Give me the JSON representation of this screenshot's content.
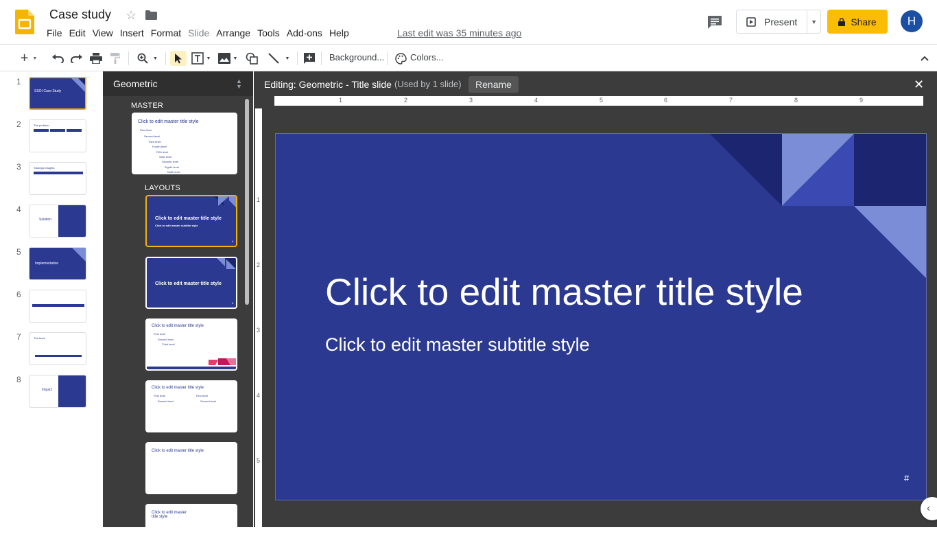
{
  "header": {
    "doc_title": "Case study",
    "menu": [
      "File",
      "Edit",
      "View",
      "Insert",
      "Format",
      "Slide",
      "Arrange",
      "Tools",
      "Add-ons",
      "Help"
    ],
    "last_edit": "Last edit was 35 minutes ago",
    "present_label": "Present",
    "share_label": "Share",
    "avatar_initial": "H"
  },
  "toolbar": {
    "background_label": "Background...",
    "colors_label": "Colors..."
  },
  "filmstrip": {
    "slides": [
      {
        "num": "1",
        "text": "SSOI Case Study"
      },
      {
        "num": "2",
        "text": "The problem"
      },
      {
        "num": "3",
        "text": "Strategic insights"
      },
      {
        "num": "4",
        "text": "Solution"
      },
      {
        "num": "5",
        "text": "Implementation"
      },
      {
        "num": "6",
        "text": ""
      },
      {
        "num": "7",
        "text": "The team"
      },
      {
        "num": "8",
        "text": "Impact"
      }
    ]
  },
  "theme_panel": {
    "theme_name": "Geometric",
    "master_label": "MASTER",
    "layouts_label": "LAYOUTS",
    "master_title": "Click to edit master title style",
    "master_levels": [
      "First level",
      "Second level",
      "Third level",
      "Fourth level",
      "Fifth level",
      "Sixth level",
      "Seventh level",
      "Eighth level",
      "Ninth level"
    ],
    "layout_title": "Click to edit master title style",
    "layout_subtitle": "Click to edit master subtitle style",
    "layout_num": "#"
  },
  "editor": {
    "editing_label": "Editing: Geometric - Title slide",
    "used_label": "(Used by 1 slide)",
    "rename_label": "Rename",
    "ruler_h": [
      "1",
      "2",
      "3",
      "4",
      "5",
      "6",
      "7",
      "8",
      "9"
    ],
    "ruler_v": [
      "1",
      "2",
      "3",
      "4",
      "5"
    ],
    "slide": {
      "title": "Click to edit master title style",
      "subtitle": "Click to edit master subtitle style",
      "number": "#"
    }
  },
  "colors": {
    "accent": "#fbbc04",
    "slide_bg": "#2b3990",
    "selection": "#f4b400",
    "avatar": "#1a4fa3"
  }
}
